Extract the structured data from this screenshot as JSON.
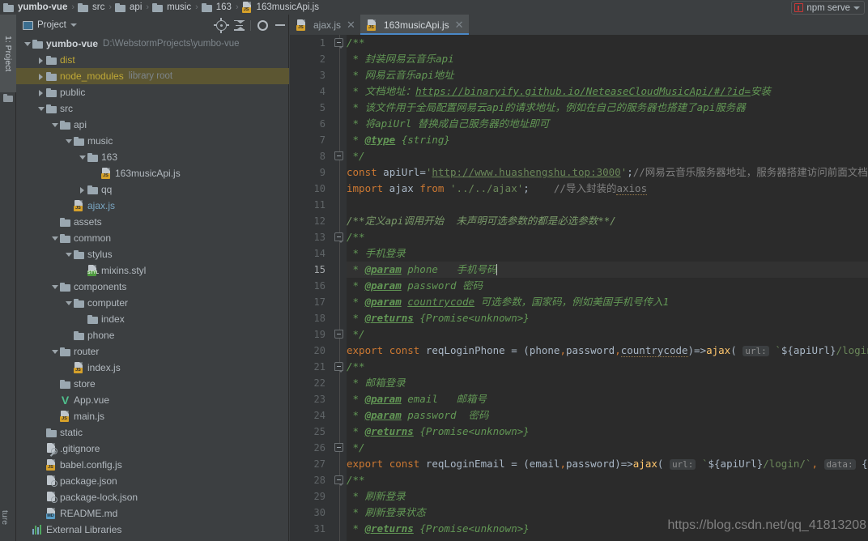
{
  "breadcrumb": {
    "items": [
      {
        "label": "yumbo-vue",
        "icon": "folder-icon",
        "bold": true
      },
      {
        "label": "src",
        "icon": "folder-icon",
        "bold": false
      },
      {
        "label": "api",
        "icon": "folder-icon",
        "bold": false
      },
      {
        "label": "music",
        "icon": "folder-icon",
        "bold": false
      },
      {
        "label": "163",
        "icon": "folder-icon",
        "bold": false
      },
      {
        "label": "163musicApi.js",
        "icon": "js-file-icon",
        "bold": false
      }
    ],
    "separator": "›"
  },
  "run_config": {
    "label": "npm serve",
    "icon": "npm-icon",
    "dropdown_icon": "chevron-down-icon"
  },
  "tool_window_strip": {
    "project_tab": "1: Project",
    "structure_tab": "ture",
    "folder_icon": "folder-icon"
  },
  "project_panel": {
    "title": "Project",
    "title_icon": "project-icon",
    "dropdown_icon": "chevron-down-icon",
    "toolbar": [
      {
        "name": "locate-icon",
        "tooltip": "Select Opened File"
      },
      {
        "name": "collapse-all-icon",
        "tooltip": "Collapse All"
      },
      {
        "name": "gear-icon",
        "tooltip": "Settings"
      },
      {
        "name": "minimize-icon",
        "tooltip": "Hide"
      }
    ],
    "tree": [
      {
        "label": "yumbo-vue",
        "sub": "D:\\WebstormProjects\\yumbo-vue",
        "indent": 0,
        "arrow": "down",
        "icon": "folder-icon",
        "style": "root"
      },
      {
        "label": "dist",
        "sub": "",
        "indent": 1,
        "arrow": "right",
        "icon": "folder-icon",
        "style": "yellow"
      },
      {
        "label": "node_modules",
        "sub": "library root",
        "indent": 1,
        "arrow": "right",
        "icon": "folder-icon",
        "style": "yellow",
        "highlight": true
      },
      {
        "label": "public",
        "sub": "",
        "indent": 1,
        "arrow": "right",
        "icon": "folder-icon",
        "style": "plain"
      },
      {
        "label": "src",
        "sub": "",
        "indent": 1,
        "arrow": "down",
        "icon": "folder-icon",
        "style": "plain"
      },
      {
        "label": "api",
        "sub": "",
        "indent": 2,
        "arrow": "down",
        "icon": "folder-icon",
        "style": "plain"
      },
      {
        "label": "music",
        "sub": "",
        "indent": 3,
        "arrow": "down",
        "icon": "folder-icon",
        "style": "plain"
      },
      {
        "label": "163",
        "sub": "",
        "indent": 4,
        "arrow": "down",
        "icon": "folder-icon",
        "style": "plain"
      },
      {
        "label": "163musicApi.js",
        "sub": "",
        "indent": 5,
        "arrow": "none",
        "icon": "js-file-icon",
        "style": "plain"
      },
      {
        "label": "qq",
        "sub": "",
        "indent": 4,
        "arrow": "right",
        "icon": "folder-icon",
        "style": "plain"
      },
      {
        "label": "ajax.js",
        "sub": "",
        "indent": 3,
        "arrow": "none",
        "icon": "js-file-icon",
        "style": "blue"
      },
      {
        "label": "assets",
        "sub": "",
        "indent": 2,
        "arrow": "none",
        "icon": "folder-icon",
        "style": "plain"
      },
      {
        "label": "common",
        "sub": "",
        "indent": 2,
        "arrow": "down",
        "icon": "folder-icon",
        "style": "plain"
      },
      {
        "label": "stylus",
        "sub": "",
        "indent": 3,
        "arrow": "down",
        "icon": "folder-icon",
        "style": "plain"
      },
      {
        "label": "mixins.styl",
        "sub": "",
        "indent": 4,
        "arrow": "none",
        "icon": "styl-file-icon",
        "style": "plain"
      },
      {
        "label": "components",
        "sub": "",
        "indent": 2,
        "arrow": "down",
        "icon": "folder-icon",
        "style": "plain"
      },
      {
        "label": "computer",
        "sub": "",
        "indent": 3,
        "arrow": "down",
        "icon": "folder-icon",
        "style": "plain"
      },
      {
        "label": "index",
        "sub": "",
        "indent": 4,
        "arrow": "none",
        "icon": "folder-icon",
        "style": "plain"
      },
      {
        "label": "phone",
        "sub": "",
        "indent": 3,
        "arrow": "none",
        "icon": "folder-icon",
        "style": "plain"
      },
      {
        "label": "router",
        "sub": "",
        "indent": 2,
        "arrow": "down",
        "icon": "folder-icon",
        "style": "plain"
      },
      {
        "label": "index.js",
        "sub": "",
        "indent": 3,
        "arrow": "none",
        "icon": "js-file-icon",
        "style": "plain"
      },
      {
        "label": "store",
        "sub": "",
        "indent": 2,
        "arrow": "none",
        "icon": "folder-icon",
        "style": "plain"
      },
      {
        "label": "App.vue",
        "sub": "",
        "indent": 2,
        "arrow": "none",
        "icon": "vue-file-icon",
        "style": "plain"
      },
      {
        "label": "main.js",
        "sub": "",
        "indent": 2,
        "arrow": "none",
        "icon": "js-file-icon",
        "style": "plain"
      },
      {
        "label": "static",
        "sub": "",
        "indent": 1,
        "arrow": "none",
        "icon": "folder-icon",
        "style": "plain"
      },
      {
        "label": ".gitignore",
        "sub": "",
        "indent": 1,
        "arrow": "none",
        "icon": "gitignore-file-icon",
        "style": "plain"
      },
      {
        "label": "babel.config.js",
        "sub": "",
        "indent": 1,
        "arrow": "none",
        "icon": "js-file-icon",
        "style": "plain"
      },
      {
        "label": "package.json",
        "sub": "",
        "indent": 1,
        "arrow": "none",
        "icon": "json-file-icon",
        "style": "plain"
      },
      {
        "label": "package-lock.json",
        "sub": "",
        "indent": 1,
        "arrow": "none",
        "icon": "json-file-icon",
        "style": "plain"
      },
      {
        "label": "README.md",
        "sub": "",
        "indent": 1,
        "arrow": "none",
        "icon": "md-file-icon",
        "style": "plain"
      },
      {
        "label": "External Libraries",
        "sub": "",
        "indent": 0,
        "arrow": "none",
        "icon": "libraries-icon",
        "style": "plain"
      }
    ]
  },
  "editor": {
    "tabs": [
      {
        "label": "ajax.js",
        "icon": "js-file-icon",
        "active": false,
        "close_icon": "close-icon"
      },
      {
        "label": "163musicApi.js",
        "icon": "js-file-icon",
        "active": true,
        "close_icon": "close-icon"
      }
    ],
    "current_line": 15,
    "first_line": 1,
    "last_line": 31,
    "lines": [
      {
        "n": 1,
        "text": "/**"
      },
      {
        "n": 2,
        "text": " * 封装网易云音乐api"
      },
      {
        "n": 3,
        "text": " * 网易云音乐api地址"
      },
      {
        "n": 4,
        "text": " * 文档地址：https://binaryify.github.io/NeteaseCloudMusicApi/#/?id=安装"
      },
      {
        "n": 5,
        "text": " * 该文件用于全局配置网易云api的请求地址，例如在自己的服务器也搭建了api服务器"
      },
      {
        "n": 6,
        "text": " * 将apiUrl 替换成自己服务器的地址即可"
      },
      {
        "n": 7,
        "text": " * @type {string}"
      },
      {
        "n": 8,
        "text": " */"
      },
      {
        "n": 9,
        "text": "const apiUrl='http://www.huashengshu.top:3000';//网易云音乐服务器地址，服务器搭建访问前面文档地"
      },
      {
        "n": 10,
        "text": "import ajax from '../../ajax';    //导入封装的axios"
      },
      {
        "n": 11,
        "text": ""
      },
      {
        "n": 12,
        "text": "/**定义api调用开始  未声明可选参数的都是必选参数**/"
      },
      {
        "n": 13,
        "text": "/**"
      },
      {
        "n": 14,
        "text": " * 手机登录"
      },
      {
        "n": 15,
        "text": " * @param phone   手机号码"
      },
      {
        "n": 16,
        "text": " * @param password 密码"
      },
      {
        "n": 17,
        "text": " * @param countrycode 可选参数，国家码，例如美国手机号传入1"
      },
      {
        "n": 18,
        "text": " * @returns {Promise<unknown>}"
      },
      {
        "n": 19,
        "text": " */"
      },
      {
        "n": 20,
        "text": "export const reqLoginPhone = (phone,password,countrycode)=>ajax( url: `${apiUrl}/login/cellph"
      },
      {
        "n": 21,
        "text": "/**"
      },
      {
        "n": 22,
        "text": " * 邮箱登录"
      },
      {
        "n": 23,
        "text": " * @param email   邮箱号"
      },
      {
        "n": 24,
        "text": " * @param password  密码"
      },
      {
        "n": 25,
        "text": " * @returns {Promise<unknown>}"
      },
      {
        "n": 26,
        "text": " */"
      },
      {
        "n": 27,
        "text": "export const reqLoginEmail = (email,password)=>ajax( url: `${apiUrl}/login/`, data: {email,pas"
      },
      {
        "n": 28,
        "text": "/**"
      },
      {
        "n": 29,
        "text": " * 刷新登录"
      },
      {
        "n": 30,
        "text": " * 刷新登录状态"
      },
      {
        "n": 31,
        "text": " * @returns {Promise<unknown>}"
      }
    ],
    "parameter_hints": [
      "url:",
      "data:"
    ],
    "watermark": "https://blog.csdn.net/qq_41813208"
  },
  "colors": {
    "editor_bg": "#2b2b2b",
    "panel_bg": "#3c3f41",
    "gutter_bg": "#313335",
    "comment_green": "#629755",
    "keyword_orange": "#cc7832",
    "string_green": "#6a8759",
    "function_yellow": "#ffc66d",
    "number_blue": "#6897bb",
    "tab_underline": "#4a88c7",
    "highlight_olive": "#5c5632",
    "npm_red": "#cb3837",
    "vue_green": "#4fc08d"
  }
}
